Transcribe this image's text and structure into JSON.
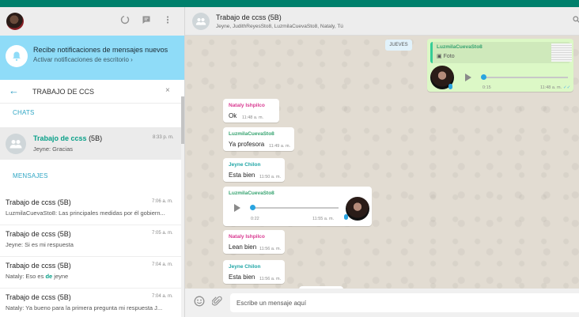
{
  "left": {
    "notification": {
      "title": "Recibe notificaciones de mensajes nuevos",
      "link": "Activar notificaciones de escritorio ›"
    },
    "search": {
      "query": "TRABAJO DE CCS",
      "clear_icon": "×",
      "back_icon": "←"
    },
    "chats_label": "CHATS",
    "selected_chat": {
      "name_highlight": "Trabajo de ccss",
      "name_suffix": "(5B)",
      "time": "8:33 p. m.",
      "preview": "Jeyne: Gracias"
    },
    "messages_label": "MENSAJES",
    "messages": [
      {
        "title": "Trabajo de ccss (5B)",
        "time": "7:06 a. m.",
        "preview": "LuzmilaCuevaSto8: Las principales medidas por él gobiern..."
      },
      {
        "title": "Trabajo de ccss (5B)",
        "time": "7:05 a. m.",
        "preview": "Jeyne: Si es mi respuesta"
      },
      {
        "title": "Trabajo de ccss (5B)",
        "time": "7:04 a. m.",
        "preview_a": "Nataly: Eso es ",
        "preview_b": "de",
        "preview_c": " jeyne"
      },
      {
        "title": "Trabajo de ccss (5B)",
        "time": "7:04 a. m.",
        "preview": "Nataly: Ya bueno para la primera pregunta mi respuesta J..."
      }
    ]
  },
  "conversation": {
    "title": "Trabajo de ccss (5B)",
    "members": "Jeyne, JudithReyesSto8, LuzmilaCuevaSto8, Nataly, Tú",
    "date_chip": "JUEVES",
    "outgoing_voice": {
      "quote_name": "LuzmilaCuevaSto8",
      "quote_text": "Foto",
      "camera_icon": "▣",
      "duration": "0:15",
      "time": "11:48 a. m.",
      "ticks": "✓✓"
    },
    "messages": [
      {
        "sender": "Nataly Ishpilco",
        "text": "Ok",
        "time": "11:48 a. m."
      },
      {
        "sender": "LuzmilaCuevaSto8",
        "text": "Ya profesora",
        "time": "11:49 a. m."
      },
      {
        "sender": "Jeyne Chilon",
        "text": "Esta bien",
        "time": "11:50 a. m."
      },
      {
        "sender": "LuzmilaCuevaSto8",
        "duration": "0:22",
        "time": "11:55 a. m."
      },
      {
        "sender": "Nataly Ishpilco",
        "text": "Lean bien",
        "time": "11:56 a. m."
      },
      {
        "sender": "Jeyne Chilon",
        "text": "Esta bien",
        "time": "11:56 a. m."
      }
    ],
    "composer": {
      "placeholder": "Escribe un mensaje aquí"
    }
  },
  "colors": {
    "accent": "#00806c",
    "sender_pink": "#d93a91",
    "sender_green": "#35a36f",
    "sender_teal": "#1fa5a5",
    "outgoing": "#dcf8c6",
    "notification": "#8fdcf8"
  }
}
